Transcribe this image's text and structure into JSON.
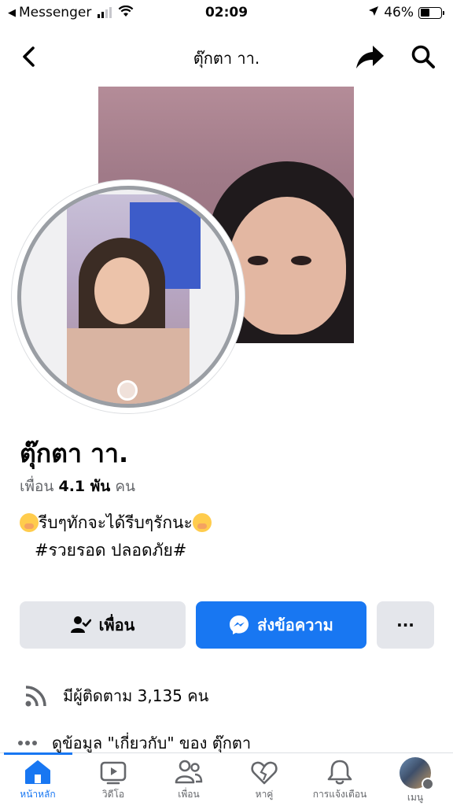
{
  "status_bar": {
    "back_app": "Messenger",
    "time": "02:09",
    "battery": "46%",
    "battery_level": 0.46
  },
  "header": {
    "title": "ตุ๊กตา าา."
  },
  "profile": {
    "name": "ตุ๊กตา าา.",
    "friends_label": "เพื่อน",
    "friends_count": "4.1 พัน",
    "friends_unit": "คน",
    "bio_line1": "รีบๆทักจะได้รีบๆรักนะ",
    "bio_line2": "#รวยรอด ปลอดภัย#"
  },
  "actions": {
    "friends_button": "เพื่อน",
    "message_button": "ส่งข้อความ",
    "more_button": "···"
  },
  "details": {
    "followers": "มีผู้ติดตาม 3,135 คน",
    "about": "ดูข้อมูล \"เกี่ยวกับ\" ของ ตุ๊กตา"
  },
  "tabs": [
    {
      "label": "หน้าหลัก",
      "icon": "home-icon",
      "active": true
    },
    {
      "label": "วิดีโอ",
      "icon": "video-icon",
      "active": false
    },
    {
      "label": "เพื่อน",
      "icon": "friends-icon",
      "active": false
    },
    {
      "label": "หาคู่",
      "icon": "dating-icon",
      "active": false
    },
    {
      "label": "การแจ้งเตือน",
      "icon": "bell-icon",
      "active": false
    },
    {
      "label": "เมนู",
      "icon": "menu-avatar",
      "active": false
    }
  ],
  "colors": {
    "accent": "#1877f2",
    "secondary_button": "#e4e6eb",
    "muted_text": "#65676b"
  }
}
